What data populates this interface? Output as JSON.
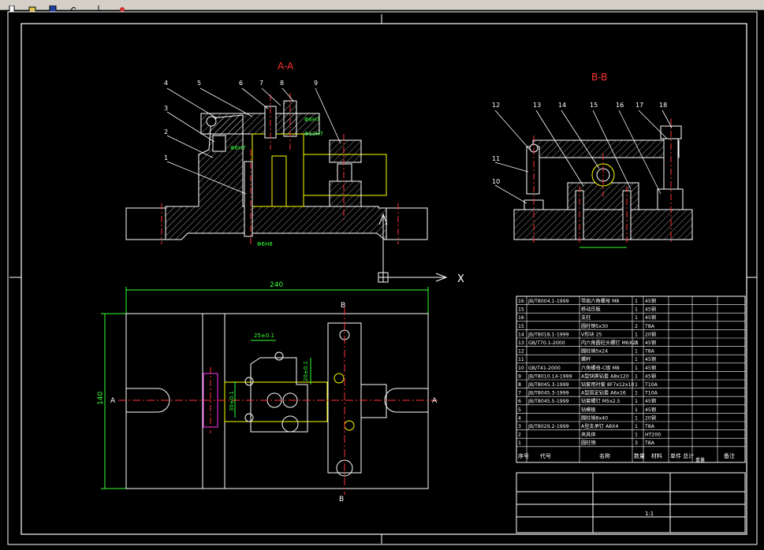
{
  "toolbar": {
    "icons": [
      "new-file-icon",
      "open-file-icon",
      "save-icon",
      "undo-icon",
      "cut-icon",
      "paint-icon"
    ]
  },
  "drawing": {
    "section_aa": "A-A",
    "section_bb": "B-B",
    "axis_x": "X",
    "dim_240": "240",
    "dim_140": "140",
    "dim_25": "25±0.1",
    "dim_20": "20±0.1",
    "dim_30": "30±0.1",
    "label_a_left": "A",
    "label_a_right": "A",
    "label_b_top": "B",
    "label_b_bottom": "B",
    "fit_6h7": "Φ6H7",
    "fit_12h7": "Φ12H7",
    "fit_6h8": "Φ6H8",
    "callouts_aa": [
      "4",
      "5",
      "6",
      "7",
      "8",
      "9",
      "3",
      "2",
      "1"
    ],
    "callouts_bb": [
      "12",
      "13",
      "14",
      "15",
      "16",
      "17",
      "18",
      "11",
      "10"
    ]
  },
  "bom": {
    "rows": [
      {
        "no": "16",
        "code": "JB/T8004.1-1999",
        "name": "带肩六角螺母 M8",
        "qty": "1",
        "mat": "45钢"
      },
      {
        "no": "15",
        "code": "",
        "name": "移动压板",
        "qty": "1",
        "mat": "45钢"
      },
      {
        "no": "16",
        "code": "",
        "name": "支柱",
        "qty": "1",
        "mat": "45钢"
      },
      {
        "no": "15",
        "code": "",
        "name": "圆柱销5x30",
        "qty": "2",
        "mat": "T8A"
      },
      {
        "no": "14",
        "code": "JB/T8018.1-1999",
        "name": "V形块 25",
        "qty": "1",
        "mat": "20钢"
      },
      {
        "no": "13",
        "code": "GB/T70.1-2000",
        "name": "内六角圆柱头螺钉 M6X25",
        "qty": "2",
        "mat": "45钢"
      },
      {
        "no": "12",
        "code": "",
        "name": "圆柱销5x24",
        "qty": "1",
        "mat": "T8A"
      },
      {
        "no": "11",
        "code": "",
        "name": "螺杆",
        "qty": "1",
        "mat": "45钢"
      },
      {
        "no": "10",
        "code": "GB/T41-2000",
        "name": "六角螺母-C级 M8",
        "qty": "1",
        "mat": "45钢"
      },
      {
        "no": "9",
        "code": "JB/T8010.14-1999",
        "name": "A型快换钻套 A8x120",
        "qty": "1",
        "mat": "45钢"
      },
      {
        "no": "8",
        "code": "JB/T8045.3-1999",
        "name": "钻套用衬套 8F7x12x10",
        "qty": "1",
        "mat": "T10A"
      },
      {
        "no": "7",
        "code": "JB/T8045.3-1999",
        "name": "A型固定钻套 A6x16",
        "qty": "1",
        "mat": "T10A"
      },
      {
        "no": "6",
        "code": "JB/T8045.5-1999",
        "name": "钻套螺钉 M5x2.5",
        "qty": "1",
        "mat": "45钢"
      },
      {
        "no": "5",
        "code": "",
        "name": "钻模板",
        "qty": "1",
        "mat": "45钢"
      },
      {
        "no": "4",
        "code": "",
        "name": "圆柱销8x40",
        "qty": "1",
        "mat": "20钢"
      },
      {
        "no": "3",
        "code": "JB/T8029.2-1999",
        "name": "A型支承钉 A8X4",
        "qty": "1",
        "mat": "T8A"
      },
      {
        "no": "2",
        "code": "",
        "name": "夹具体",
        "qty": "1",
        "mat": "HT200"
      },
      {
        "no": "1",
        "code": "",
        "name": "圆柱销",
        "qty": "3",
        "mat": "T8A"
      }
    ],
    "header": {
      "no": "序号",
      "code": "代号",
      "name": "名称",
      "qty": "数量",
      "mat": "材料",
      "unit": "单件 总计",
      "weight": "重量",
      "note": "备注"
    },
    "title_scale": "1:1"
  },
  "colors": {
    "frame": "#ffffff",
    "part": "#ffffff",
    "center": "#ff3333",
    "dim": "#33ff33",
    "hidden": "#ffff00",
    "leader": "#ffffff",
    "magenta": "#ff33ff"
  }
}
